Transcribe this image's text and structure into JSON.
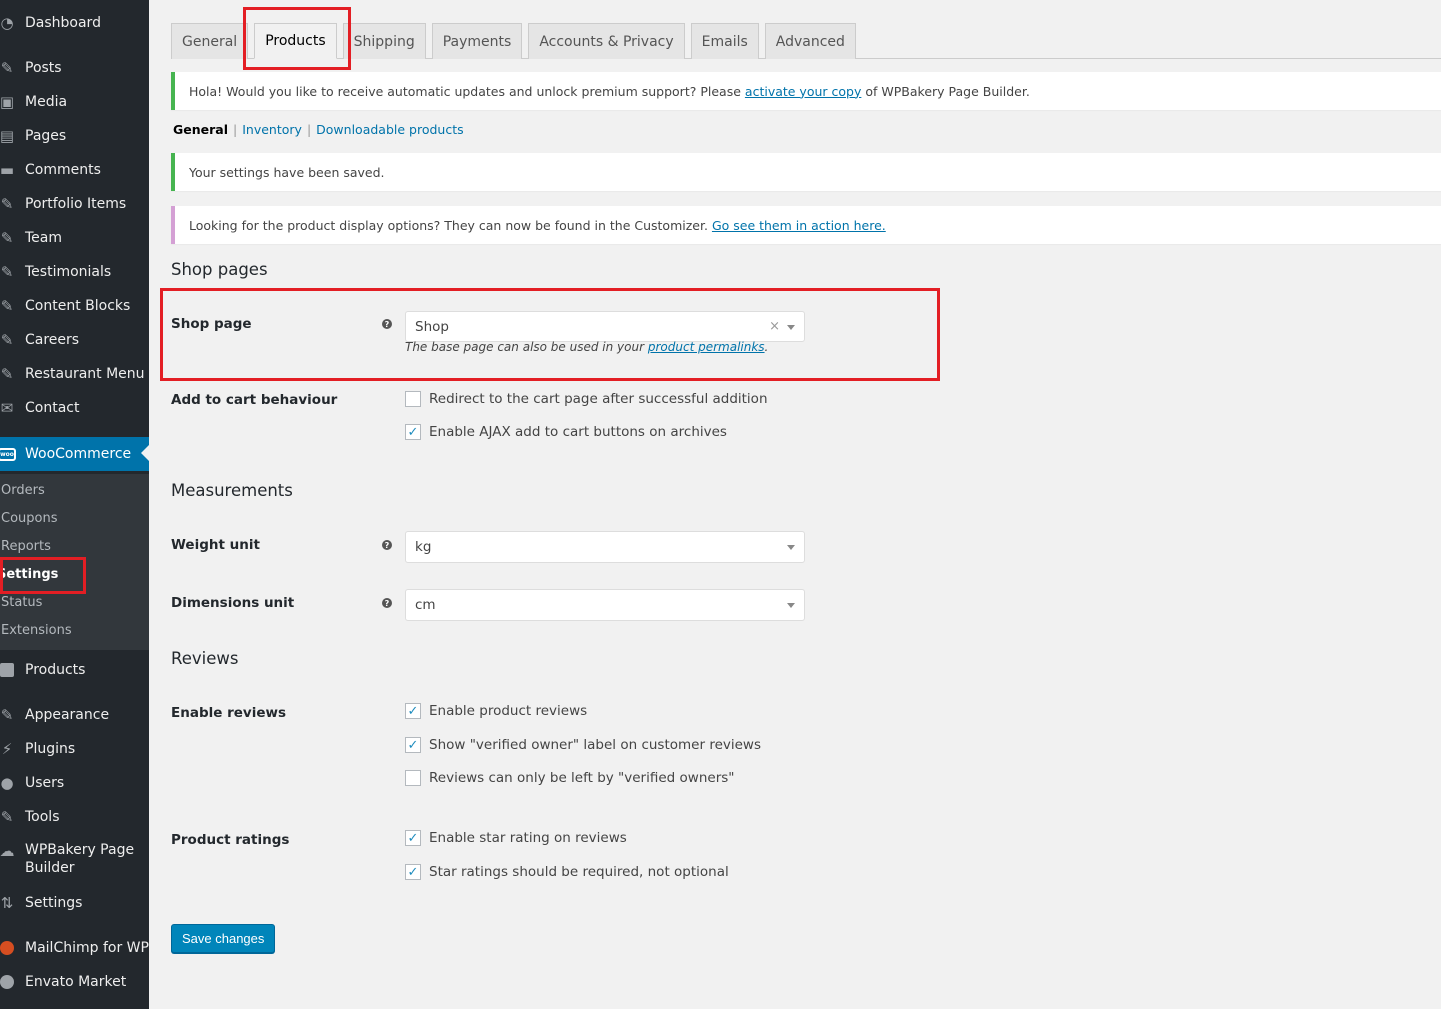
{
  "sidebar": {
    "items": [
      {
        "label": "Dashboard",
        "icon": "dashboard-icon"
      },
      {
        "label": "Posts",
        "icon": "pin-icon"
      },
      {
        "label": "Media",
        "icon": "media-icon"
      },
      {
        "label": "Pages",
        "icon": "pages-icon"
      },
      {
        "label": "Comments",
        "icon": "comment-icon"
      },
      {
        "label": "Portfolio Items",
        "icon": "pin-icon"
      },
      {
        "label": "Team",
        "icon": "pin-icon"
      },
      {
        "label": "Testimonials",
        "icon": "pin-icon"
      },
      {
        "label": "Content Blocks",
        "icon": "pin-icon"
      },
      {
        "label": "Careers",
        "icon": "pin-icon"
      },
      {
        "label": "Restaurant Menu",
        "icon": "pin-icon"
      },
      {
        "label": "Contact",
        "icon": "mail-icon"
      },
      {
        "label": "WooCommerce",
        "icon": "woo-icon"
      },
      {
        "label": "Products",
        "icon": "box-icon"
      },
      {
        "label": "Appearance",
        "icon": "brush-icon"
      },
      {
        "label": "Plugins",
        "icon": "plugin-icon"
      },
      {
        "label": "Users",
        "icon": "user-icon"
      },
      {
        "label": "Tools",
        "icon": "wrench-icon"
      },
      {
        "label": "WPBakery Page",
        "label2": "Builder",
        "icon": "wpbakery-icon"
      },
      {
        "label": "Settings",
        "icon": "settings-icon"
      },
      {
        "label": "MailChimp for WP",
        "icon": "mailchimp-icon"
      },
      {
        "label": "Envato Market",
        "icon": "envato-icon"
      }
    ],
    "woo_icon_text": "woo",
    "submenu": [
      "Orders",
      "Coupons",
      "Reports",
      "Settings",
      "Status",
      "Extensions"
    ]
  },
  "tabs": [
    "General",
    "Products",
    "Shipping",
    "Payments",
    "Accounts & Privacy",
    "Emails",
    "Advanced"
  ],
  "notice_update": {
    "before": "Hola! Would you like to receive automatic updates and unlock premium support? Please",
    "link": "activate your copy",
    "after": "of WPBakery Page Builder."
  },
  "subnav": {
    "current": "General",
    "links": [
      "Inventory",
      "Downloadable products"
    ],
    "sep": "|"
  },
  "notice_saved": "Your settings have been saved.",
  "notice_display": {
    "text": "Looking for the product display options? They can now be found in the Customizer.",
    "link": "Go see them in action here."
  },
  "shop_pages": {
    "heading": "Shop pages",
    "shop_page_label": "Shop page",
    "shop_page_value": "Shop",
    "shop_page_desc_before": "The base page can also be used in your",
    "shop_page_desc_link": "product permalinks",
    "shop_page_desc_after": ".",
    "add_to_cart_label": "Add to cart behaviour",
    "redirect_label": "Redirect to the cart page after successful addition",
    "redirect_checked": false,
    "ajax_label": "Enable AJAX add to cart buttons on archives",
    "ajax_checked": true
  },
  "measurements": {
    "heading": "Measurements",
    "weight_label": "Weight unit",
    "weight_value": "kg",
    "dimensions_label": "Dimensions unit",
    "dimensions_value": "cm"
  },
  "reviews": {
    "heading": "Reviews",
    "enable_label": "Enable reviews",
    "opt1": "Enable product reviews",
    "opt2": "Show \"verified owner\" label on customer reviews",
    "opt3": "Reviews can only be left by \"verified owners\"",
    "ratings_label": "Product ratings",
    "opt4": "Enable star rating on reviews",
    "opt5": "Star ratings should be required, not optional"
  },
  "save_button": "Save changes",
  "help_glyph": "?",
  "check_glyph": "✓",
  "clear_glyph": "×",
  "colors": {
    "sidebar": "#23282d",
    "accent": "#0073aa",
    "highlight": "#e31e24",
    "success": "#46b450",
    "info": "#d4a0d4"
  }
}
